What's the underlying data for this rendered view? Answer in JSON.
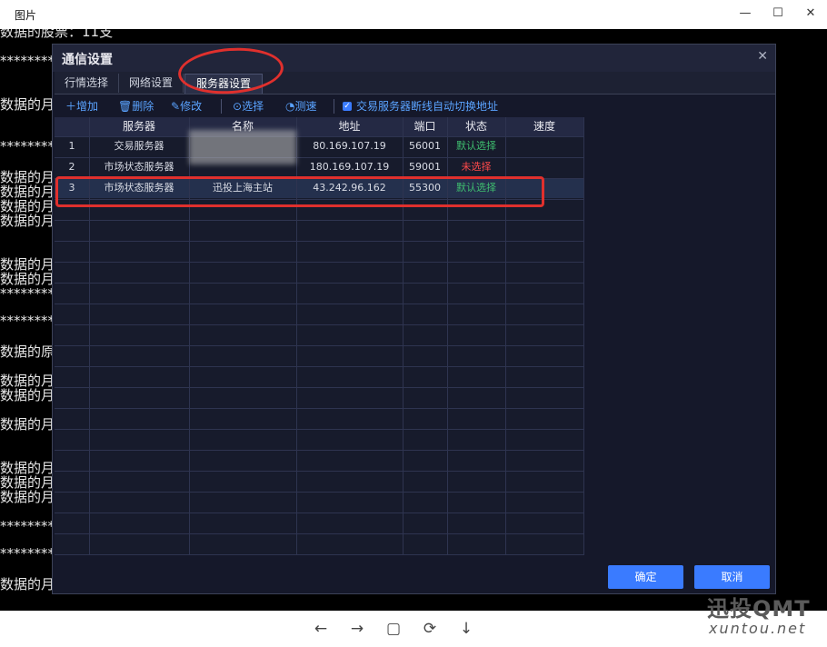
{
  "viewer": {
    "title": "图片",
    "window_buttons": {
      "minimize": "—",
      "maximize": "☐",
      "close": "✕"
    },
    "nav_icons": {
      "prev": "←",
      "next": "→",
      "fit": "▢",
      "rotate": "⟳",
      "download": "↓"
    }
  },
  "console": {
    "top_line": "数据的股票：11支",
    "stars": "**********",
    "partial": "数据的月",
    "partial2": "数据的原"
  },
  "dialog": {
    "title": "通信设置",
    "tabs": [
      "行情选择",
      "网络设置",
      "服务器设置"
    ],
    "active_tab": 2,
    "toolbar": {
      "add": "增加",
      "delete": "删除",
      "edit": "修改",
      "select": "选择",
      "speed_test": "测速",
      "auto_switch": "交易服务器断线自动切换地址"
    },
    "columns": [
      "服务器",
      "名称",
      "地址",
      "端口",
      "状态",
      "速度"
    ],
    "rows": [
      {
        "idx": "1",
        "server": "交易服务器",
        "name": "",
        "address": "80.169.107.19",
        "port": "56001",
        "status": "默认选择",
        "status_color": "#3fbf6f"
      },
      {
        "idx": "2",
        "server": "市场状态服务器",
        "name": "",
        "address": "180.169.107.19",
        "port": "59001",
        "status": "未选择",
        "status_color": "#ff4a4a"
      },
      {
        "idx": "3",
        "server": "市场状态服务器",
        "name": "迅投上海主站",
        "address": "43.242.96.162",
        "port": "55300",
        "status": "默认选择",
        "status_color": "#3fbf6f"
      }
    ],
    "ok": "确定",
    "cancel": "取消"
  },
  "watermark": {
    "brand": "迅投QMT",
    "site": "xuntou.net"
  }
}
